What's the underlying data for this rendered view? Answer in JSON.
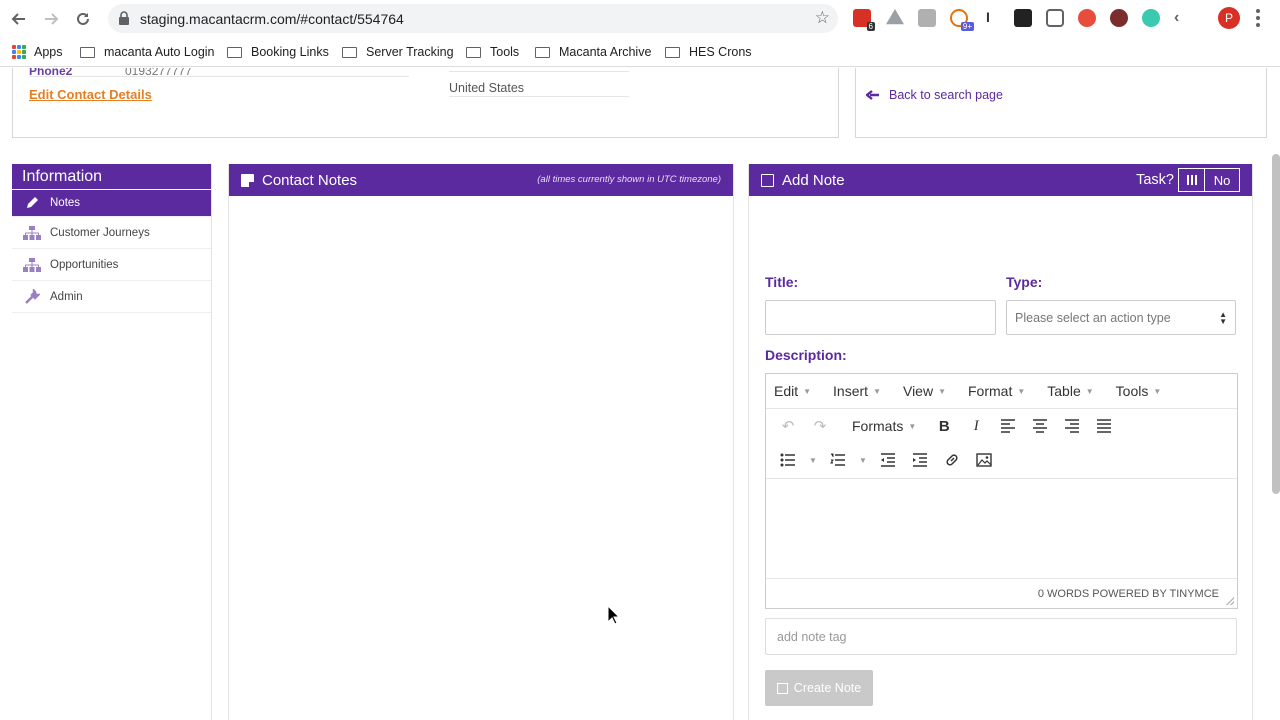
{
  "browser": {
    "url": "staging.macantacrm.com/#contact/554764",
    "extension_badges": [
      "6",
      "9+"
    ],
    "profile_initial": "P",
    "bookmarks": [
      {
        "label": "Apps",
        "type": "apps"
      },
      {
        "label": "macanta Auto Login",
        "type": "folder"
      },
      {
        "label": "Booking Links",
        "type": "folder"
      },
      {
        "label": "Server Tracking",
        "type": "folder"
      },
      {
        "label": "Tools",
        "type": "folder"
      },
      {
        "label": "Macanta Archive",
        "type": "folder"
      },
      {
        "label": "HES Crons",
        "type": "folder"
      }
    ]
  },
  "contact": {
    "phone_label": "Phone2",
    "phone_value": "0193277777",
    "edit_link": "Edit Contact Details",
    "country": "United States"
  },
  "back_link": "Back to search page",
  "sidebar": {
    "title": "Information",
    "items": [
      {
        "label": "Notes",
        "icon": "pencil-icon",
        "active": true
      },
      {
        "label": "Customer Journeys",
        "icon": "sitemap-icon",
        "active": false
      },
      {
        "label": "Opportunities",
        "icon": "sitemap-icon",
        "active": false
      },
      {
        "label": "Admin",
        "icon": "wrench-icon",
        "active": false
      }
    ]
  },
  "notes_panel": {
    "title": "Contact Notes",
    "timezone_note": "(all times currently shown in UTC timezone)"
  },
  "add_note": {
    "title": "Add Note",
    "task_label": "Task?",
    "task_value": "No",
    "title_label": "Title:",
    "type_label": "Type:",
    "type_placeholder": "Please select an action type",
    "description_label": "Description:",
    "editor": {
      "menus": [
        "Edit",
        "Insert",
        "View",
        "Format",
        "Table",
        "Tools"
      ],
      "formats_label": "Formats",
      "status": "0 WORDS POWERED BY TINYMCE"
    },
    "tag_placeholder": "add note tag",
    "create_button": "Create Note"
  },
  "colors": {
    "brand_purple": "#5b2a9e",
    "link_orange": "#e67e22",
    "disabled_gray": "#c9c9c9"
  }
}
